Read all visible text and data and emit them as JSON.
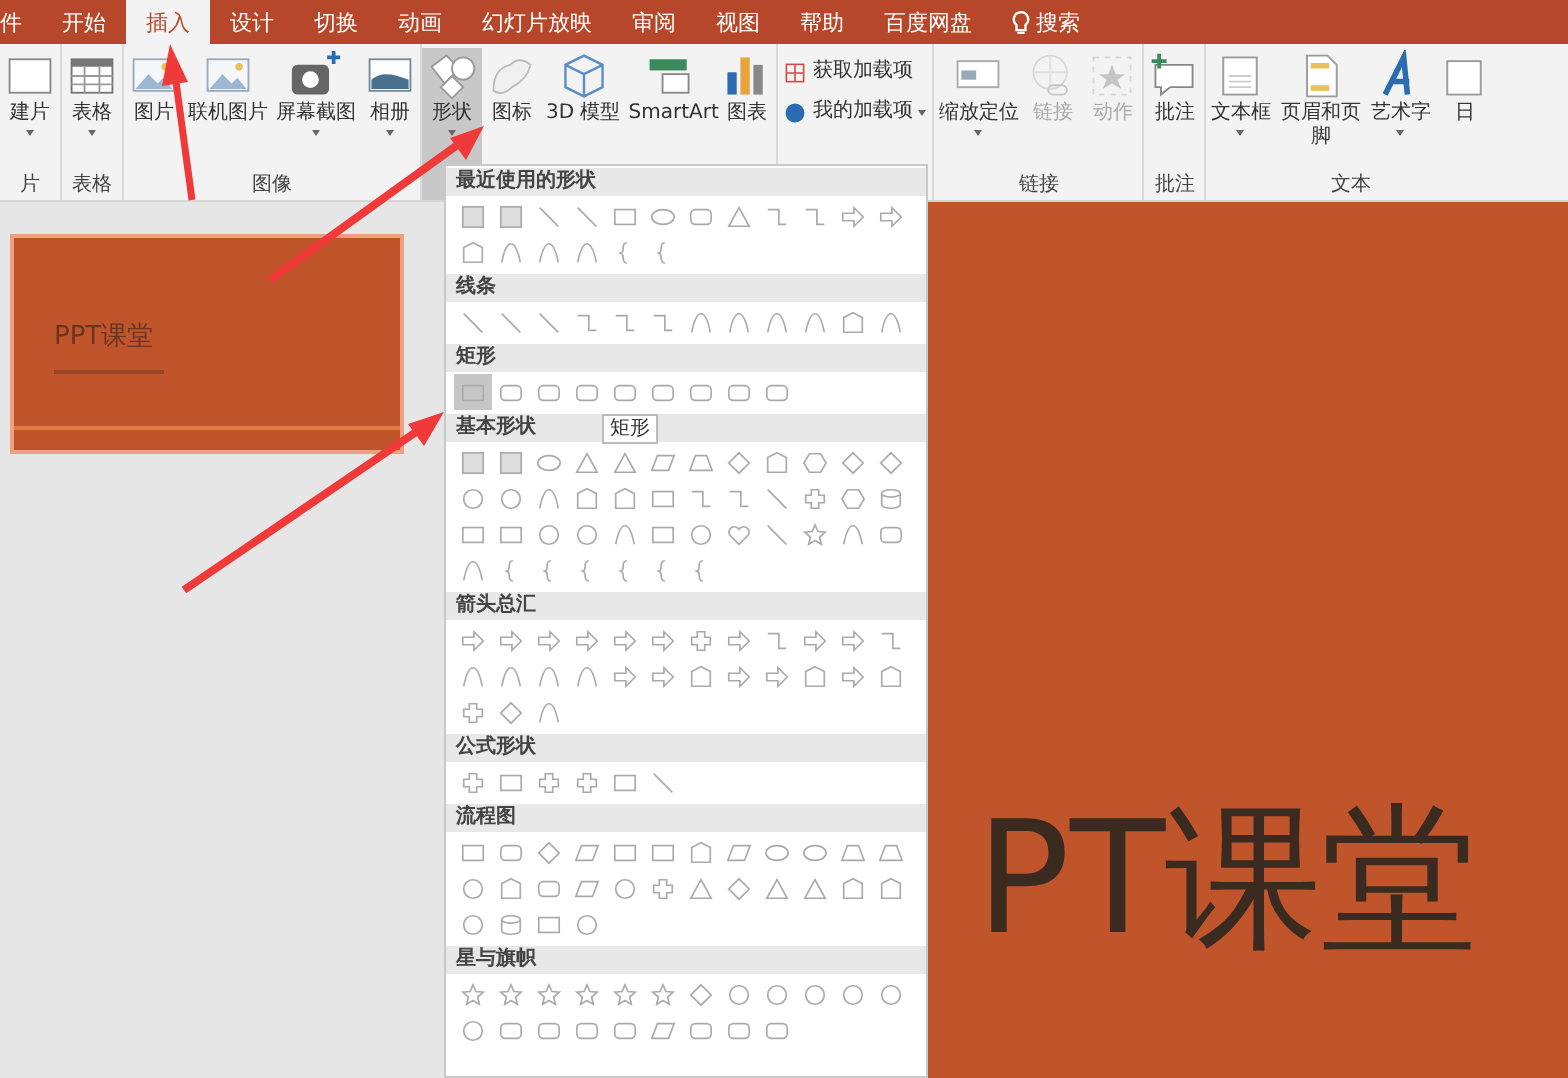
{
  "tabs": [
    {
      "label": "件",
      "selected": false,
      "kind": "text"
    },
    {
      "label": "开始",
      "selected": false,
      "kind": "text"
    },
    {
      "label": "插入",
      "selected": true,
      "kind": "text"
    },
    {
      "label": "设计",
      "selected": false,
      "kind": "text"
    },
    {
      "label": "切换",
      "selected": false,
      "kind": "text"
    },
    {
      "label": "动画",
      "selected": false,
      "kind": "text"
    },
    {
      "label": "幻灯片放映",
      "selected": false,
      "kind": "text"
    },
    {
      "label": "审阅",
      "selected": false,
      "kind": "text"
    },
    {
      "label": "视图",
      "selected": false,
      "kind": "text"
    },
    {
      "label": "帮助",
      "selected": false,
      "kind": "text"
    },
    {
      "label": "百度网盘",
      "selected": false,
      "kind": "text"
    },
    {
      "label": "搜索",
      "selected": false,
      "kind": "search"
    }
  ],
  "ribbon": [
    {
      "label": "片",
      "kind": "large",
      "items": [
        {
          "kind": "new-slide",
          "label": "建片",
          "has_menu": true,
          "pressed": false,
          "disabled": false
        }
      ]
    },
    {
      "label": "表格",
      "kind": "large",
      "items": [
        {
          "kind": "table",
          "label": "表格",
          "has_menu": true,
          "pressed": false,
          "disabled": false
        }
      ]
    },
    {
      "label": "图像",
      "kind": "large",
      "items": [
        {
          "kind": "picture",
          "label": "图片",
          "has_menu": false,
          "pressed": false,
          "disabled": false
        },
        {
          "kind": "online-picture",
          "label": "联机图片",
          "has_menu": false,
          "pressed": false,
          "disabled": false
        },
        {
          "kind": "screenshot",
          "label": "屏幕截图",
          "has_menu": true,
          "pressed": false,
          "disabled": false
        },
        {
          "kind": "album",
          "label": "相册",
          "has_menu": true,
          "pressed": false,
          "disabled": false
        }
      ]
    },
    {
      "kind": "large",
      "items": [
        {
          "kind": "shapes",
          "label": "形状",
          "has_menu": true,
          "pressed": true,
          "disabled": false
        },
        {
          "kind": "icons",
          "label": "图标",
          "has_menu": false,
          "pressed": false,
          "disabled": false
        },
        {
          "kind": "model",
          "label": "3D 模型",
          "has_menu": false,
          "pressed": false,
          "disabled": false
        },
        {
          "kind": "smartart",
          "label": "SmartArt",
          "has_menu": false,
          "pressed": false,
          "disabled": false
        },
        {
          "kind": "chart",
          "label": "图表",
          "has_menu": false,
          "pressed": false,
          "disabled": false
        }
      ]
    },
    {
      "kind": "stack",
      "items": [
        {
          "kind": "store",
          "label": "获取加载项",
          "has_menu": false,
          "pressed": false,
          "disabled": false
        },
        {
          "kind": "addins",
          "label": "我的加载项",
          "has_menu": true,
          "pressed": false,
          "disabled": false
        }
      ]
    },
    {
      "label": "链接",
      "kind": "large",
      "items": [
        {
          "kind": "zoom",
          "label": "缩放定位",
          "has_menu": true,
          "pressed": false,
          "disabled": false
        },
        {
          "kind": "link",
          "label": "链接",
          "has_menu": false,
          "pressed": false,
          "disabled": true
        },
        {
          "kind": "action",
          "label": "动作",
          "has_menu": false,
          "pressed": false,
          "disabled": true
        }
      ]
    },
    {
      "label": "批注",
      "kind": "large",
      "items": [
        {
          "kind": "comment",
          "label": "批注",
          "has_menu": false,
          "pressed": false,
          "disabled": false
        }
      ]
    },
    {
      "label": "文本",
      "kind": "large",
      "items": [
        {
          "kind": "textbox",
          "label": "文本框",
          "has_menu": true,
          "pressed": false,
          "disabled": false
        },
        {
          "kind": "header",
          "label": "页眉和页脚",
          "has_menu": false,
          "pressed": false,
          "disabled": false
        },
        {
          "kind": "wordart",
          "label": "艺术字",
          "has_menu": true,
          "pressed": false,
          "disabled": false
        },
        {
          "kind": "date",
          "label": "日",
          "has_menu": false,
          "pressed": false,
          "disabled": false
        }
      ]
    }
  ],
  "thumbnail": {
    "title": "PPT课堂",
    "selected": true
  },
  "slide": {
    "title": "PT课堂"
  },
  "shapes_menu": [
    {
      "title": "最近使用的形状",
      "shapes": [
        {
          "kind": "textbox"
        },
        {
          "kind": "textbox"
        },
        {
          "kind": "line"
        },
        {
          "kind": "line"
        },
        {
          "kind": "rectangle"
        },
        {
          "kind": "oval"
        },
        {
          "kind": "rounded-rectangle"
        },
        {
          "kind": "triangle"
        },
        {
          "kind": "elbow"
        },
        {
          "kind": "elbow"
        },
        {
          "kind": "arrow"
        },
        {
          "kind": "arrow"
        },
        {
          "kind": "pentagon"
        },
        {
          "kind": "curve"
        },
        {
          "kind": "curve"
        },
        {
          "kind": "curve"
        },
        {
          "kind": "brace"
        },
        {
          "kind": "brace"
        }
      ]
    },
    {
      "title": "线条",
      "shapes": [
        {
          "kind": "line"
        },
        {
          "kind": "line"
        },
        {
          "kind": "line"
        },
        {
          "kind": "elbow"
        },
        {
          "kind": "elbow"
        },
        {
          "kind": "elbow"
        },
        {
          "kind": "curve"
        },
        {
          "kind": "curve"
        },
        {
          "kind": "curve"
        },
        {
          "kind": "curve"
        },
        {
          "kind": "pentagon"
        },
        {
          "kind": "curve"
        }
      ]
    },
    {
      "title": "矩形",
      "tooltip": "矩形",
      "shapes": [
        {
          "kind": "rectangle",
          "selected": true
        },
        {
          "kind": "rounded-rectangle",
          "selected": false
        },
        {
          "kind": "rounded-rectangle",
          "selected": false
        },
        {
          "kind": "rounded-rectangle",
          "selected": false
        },
        {
          "kind": "rounded-rectangle",
          "selected": false
        },
        {
          "kind": "rounded-rectangle",
          "selected": false
        },
        {
          "kind": "rounded-rectangle",
          "selected": false
        },
        {
          "kind": "rounded-rectangle",
          "selected": false
        },
        {
          "kind": "rounded-rectangle",
          "selected": false
        }
      ]
    },
    {
      "title": "基本形状",
      "shapes": [
        {
          "kind": "textbox"
        },
        {
          "kind": "textbox"
        },
        {
          "kind": "oval"
        },
        {
          "kind": "triangle"
        },
        {
          "kind": "triangle"
        },
        {
          "kind": "parallelogram"
        },
        {
          "kind": "trapezoid"
        },
        {
          "kind": "diamond"
        },
        {
          "kind": "pentagon"
        },
        {
          "kind": "hexagon"
        },
        {
          "kind": "diamond"
        },
        {
          "kind": "diamond"
        },
        {
          "kind": "circle"
        },
        {
          "kind": "circle"
        },
        {
          "kind": "curve"
        },
        {
          "kind": "pentagon"
        },
        {
          "kind": "pentagon"
        },
        {
          "kind": "rectangle"
        },
        {
          "kind": "elbow"
        },
        {
          "kind": "elbow"
        },
        {
          "kind": "line"
        },
        {
          "kind": "plus"
        },
        {
          "kind": "hexagon"
        },
        {
          "kind": "cylinder"
        },
        {
          "kind": "rectangle"
        },
        {
          "kind": "rectangle"
        },
        {
          "kind": "circle"
        },
        {
          "kind": "circle"
        },
        {
          "kind": "curve"
        },
        {
          "kind": "rectangle"
        },
        {
          "kind": "circle"
        },
        {
          "kind": "heart"
        },
        {
          "kind": "line"
        },
        {
          "kind": "star"
        },
        {
          "kind": "curve"
        },
        {
          "kind": "rounded-rectangle"
        },
        {
          "kind": "curve"
        },
        {
          "kind": "brace"
        },
        {
          "kind": "brace"
        },
        {
          "kind": "brace"
        },
        {
          "kind": "brace"
        },
        {
          "kind": "brace"
        },
        {
          "kind": "brace"
        }
      ]
    },
    {
      "title": "箭头总汇",
      "shapes": [
        {
          "kind": "arrow"
        },
        {
          "kind": "arrow"
        },
        {
          "kind": "arrow"
        },
        {
          "kind": "arrow"
        },
        {
          "kind": "arrow"
        },
        {
          "kind": "arrow"
        },
        {
          "kind": "plus"
        },
        {
          "kind": "arrow"
        },
        {
          "kind": "elbow"
        },
        {
          "kind": "arrow"
        },
        {
          "kind": "arrow"
        },
        {
          "kind": "elbow"
        },
        {
          "kind": "curve"
        },
        {
          "kind": "curve"
        },
        {
          "kind": "curve"
        },
        {
          "kind": "curve"
        },
        {
          "kind": "arrow"
        },
        {
          "kind": "arrow"
        },
        {
          "kind": "pentagon"
        },
        {
          "kind": "arrow"
        },
        {
          "kind": "arrow"
        },
        {
          "kind": "pentagon"
        },
        {
          "kind": "arrow"
        },
        {
          "kind": "pentagon"
        },
        {
          "kind": "plus"
        },
        {
          "kind": "diamond"
        },
        {
          "kind": "curve"
        }
      ]
    },
    {
      "title": "公式形状",
      "shapes": [
        {
          "kind": "plus"
        },
        {
          "kind": "rectangle"
        },
        {
          "kind": "plus"
        },
        {
          "kind": "plus"
        },
        {
          "kind": "rectangle"
        },
        {
          "kind": "line"
        }
      ]
    },
    {
      "title": "流程图",
      "shapes": [
        {
          "kind": "rectangle"
        },
        {
          "kind": "rounded-rectangle"
        },
        {
          "kind": "diamond"
        },
        {
          "kind": "parallelogram"
        },
        {
          "kind": "rectangle"
        },
        {
          "kind": "rectangle"
        },
        {
          "kind": "pentagon"
        },
        {
          "kind": "parallelogram"
        },
        {
          "kind": "oval"
        },
        {
          "kind": "oval"
        },
        {
          "kind": "trapezoid"
        },
        {
          "kind": "trapezoid"
        },
        {
          "kind": "circle"
        },
        {
          "kind": "pentagon"
        },
        {
          "kind": "rounded-rectangle"
        },
        {
          "kind": "parallelogram"
        },
        {
          "kind": "circle"
        },
        {
          "kind": "plus"
        },
        {
          "kind": "triangle"
        },
        {
          "kind": "diamond"
        },
        {
          "kind": "triangle"
        },
        {
          "kind": "triangle"
        },
        {
          "kind": "pentagon"
        },
        {
          "kind": "pentagon"
        },
        {
          "kind": "circle"
        },
        {
          "kind": "cylinder"
        },
        {
          "kind": "rectangle"
        },
        {
          "kind": "circle"
        }
      ]
    },
    {
      "title": "星与旗帜",
      "shapes": [
        {
          "kind": "star"
        },
        {
          "kind": "star"
        },
        {
          "kind": "star"
        },
        {
          "kind": "star"
        },
        {
          "kind": "star"
        },
        {
          "kind": "star"
        },
        {
          "kind": "diamond"
        },
        {
          "kind": "circle"
        },
        {
          "kind": "circle"
        },
        {
          "kind": "circle"
        },
        {
          "kind": "circle"
        },
        {
          "kind": "circle"
        },
        {
          "kind": "circle"
        },
        {
          "kind": "rounded-rectangle"
        },
        {
          "kind": "rounded-rectangle"
        },
        {
          "kind": "rounded-rectangle"
        },
        {
          "kind": "rounded-rectangle"
        },
        {
          "kind": "parallelogram"
        },
        {
          "kind": "rounded-rectangle"
        },
        {
          "kind": "rounded-rectangle"
        },
        {
          "kind": "rounded-rectangle"
        }
      ]
    }
  ]
}
